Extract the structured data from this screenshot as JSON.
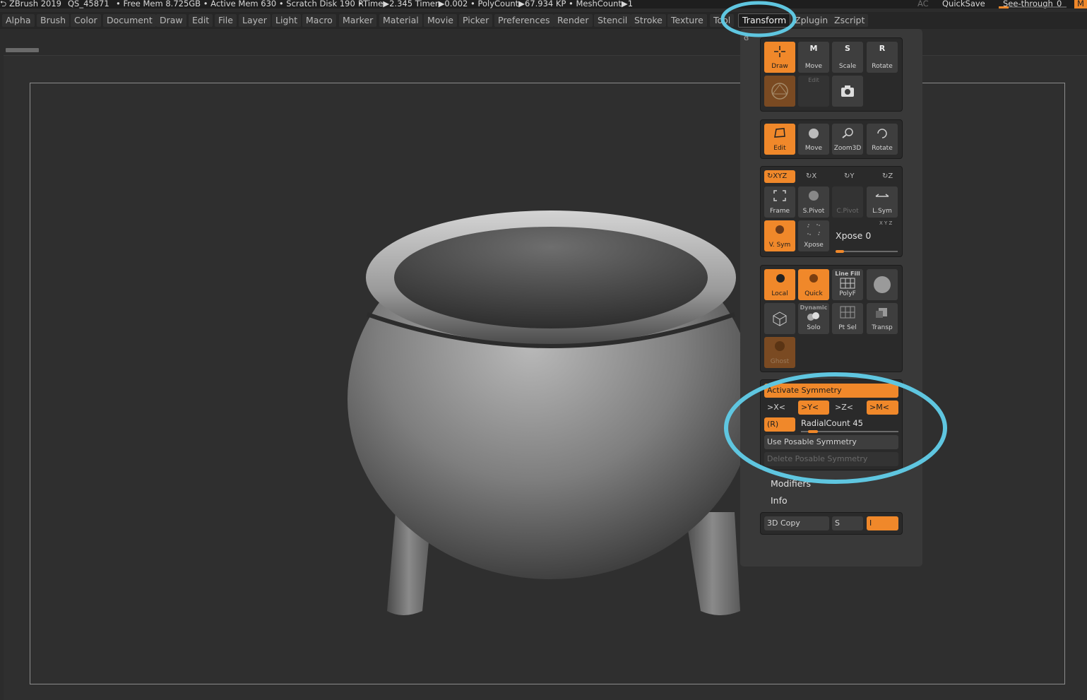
{
  "status_bar": {
    "app": "ZBrush 2019",
    "project": "QS_45871",
    "stats": "• Free Mem 8.725GB • Active Mem 630 • Scratch Disk 190 •",
    "rtime": "RTime▶2.345 Timer▶0.002 • PolyCount▶67.934 KP • MeshCount▶1",
    "ac": "AC",
    "quicksave": "QuickSave",
    "see_through": "See-through",
    "see_through_value": "0",
    "menu_toggle": "M"
  },
  "menus": [
    "Alpha",
    "Brush",
    "Color",
    "Document",
    "Draw",
    "Edit",
    "File",
    "Layer",
    "Light",
    "Macro",
    "Marker",
    "Material",
    "Movie",
    "Picker",
    "Preferences",
    "Render",
    "Stencil",
    "Stroke",
    "Texture",
    "Tool",
    "Transform",
    "Zplugin",
    "Zscript"
  ],
  "active_menu": "Transform",
  "transform": {
    "row1": [
      "Draw",
      "Move",
      "Scale",
      "Rotate"
    ],
    "row1_badges": [
      "M",
      "S",
      "R"
    ],
    "edit_ghost": "Edit",
    "row3": [
      "Edit",
      "Move",
      "Zoom3D",
      "Rotate"
    ],
    "axes": [
      "XYZ",
      "X",
      "Y",
      "Z"
    ],
    "row_pivot": [
      "Frame",
      "S.Pivot",
      "C.Pivot",
      "L.Sym"
    ],
    "vsym": "V. Sym",
    "xpose_btn": "Xpose",
    "xpose_label": "Xpose",
    "xpose_value": "0",
    "xyz_small": "X Y Z",
    "local": "Local",
    "quick": "Quick",
    "linefill_top": "Line Fill",
    "polyf": "PolyF",
    "dynamic_top": "Dynamic",
    "solo": "Solo",
    "ptsel": "Pt Sel",
    "transp": "Transp",
    "ghost": "Ghost",
    "activate_symmetry": "Activate Symmetry",
    "sym_axes": [
      ">X<",
      ">Y<",
      ">Z<",
      ">M<"
    ],
    "radial_r": "(R)",
    "radial_label": "RadialCount",
    "radial_value": "45",
    "radial_fraction": 0.07,
    "use_posable": "Use Posable Symmetry",
    "delete_posable": "Delete Posable Symmetry",
    "modifiers": "Modifiers",
    "info": "Info",
    "copy3d": "3D Copy",
    "copy_s": "S",
    "copy_i": "I"
  },
  "colors": {
    "accent": "#f0882a",
    "annotation": "#5fc6e0"
  }
}
